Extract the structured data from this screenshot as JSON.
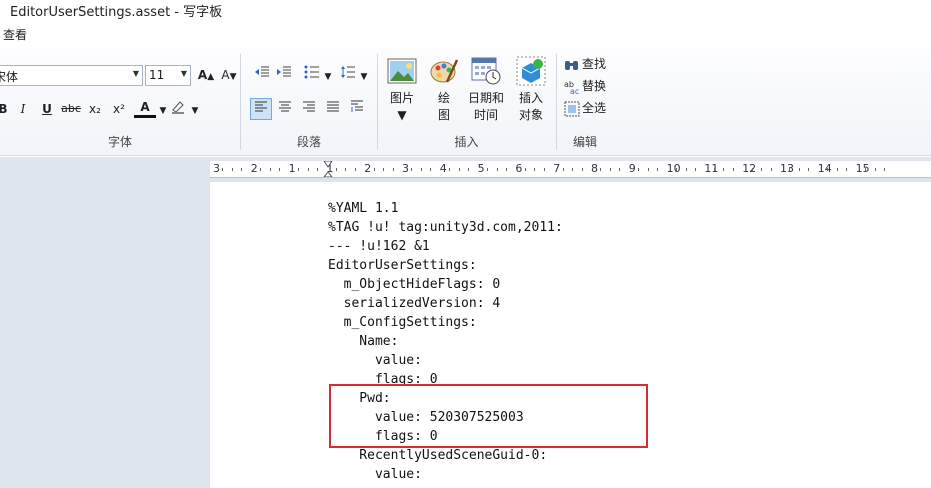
{
  "window": {
    "title": "EditorUserSettings.asset - 写字板"
  },
  "menu": {
    "view": "查看"
  },
  "font_group": {
    "label": "字体",
    "font_name": "宋体",
    "font_size": "11",
    "grow": "A",
    "shrink": "A",
    "bold": "B",
    "italic": "I",
    "underline": "U",
    "strike": "abc",
    "subscript": "x₂",
    "superscript": "x²",
    "color": "A"
  },
  "paragraph_group": {
    "label": "段落"
  },
  "insert_group": {
    "label": "插入",
    "picture": "图片",
    "paint_1": "绘",
    "paint_2": "图",
    "datetime_1": "日期和",
    "datetime_2": "时间",
    "object_1": "插入",
    "object_2": "对象"
  },
  "edit_group": {
    "label": "编辑",
    "find": "查找",
    "replace": "替换",
    "select_all": "全选"
  },
  "ruler": {
    "numbers": [
      "3",
      "2",
      "1",
      "1",
      "2",
      "3",
      "4",
      "5",
      "6",
      "7",
      "8",
      "9",
      "10",
      "11",
      "12",
      "13",
      "14",
      "15"
    ]
  },
  "document": {
    "lines": [
      "%YAML 1.1",
      "%TAG !u! tag:unity3d.com,2011:",
      "--- !u!162 &1",
      "EditorUserSettings:",
      "  m_ObjectHideFlags: 0",
      "  serializedVersion: 4",
      "  m_ConfigSettings:",
      "    Name:",
      "      value:",
      "      flags: 0",
      "    Pwd:",
      "      value: 520307525003",
      "      flags: 0",
      "    RecentlyUsedSceneGuid-0:",
      "      value:"
    ]
  },
  "colors": {
    "highlight": "#d92b36",
    "pane": "#dfe5ee"
  }
}
